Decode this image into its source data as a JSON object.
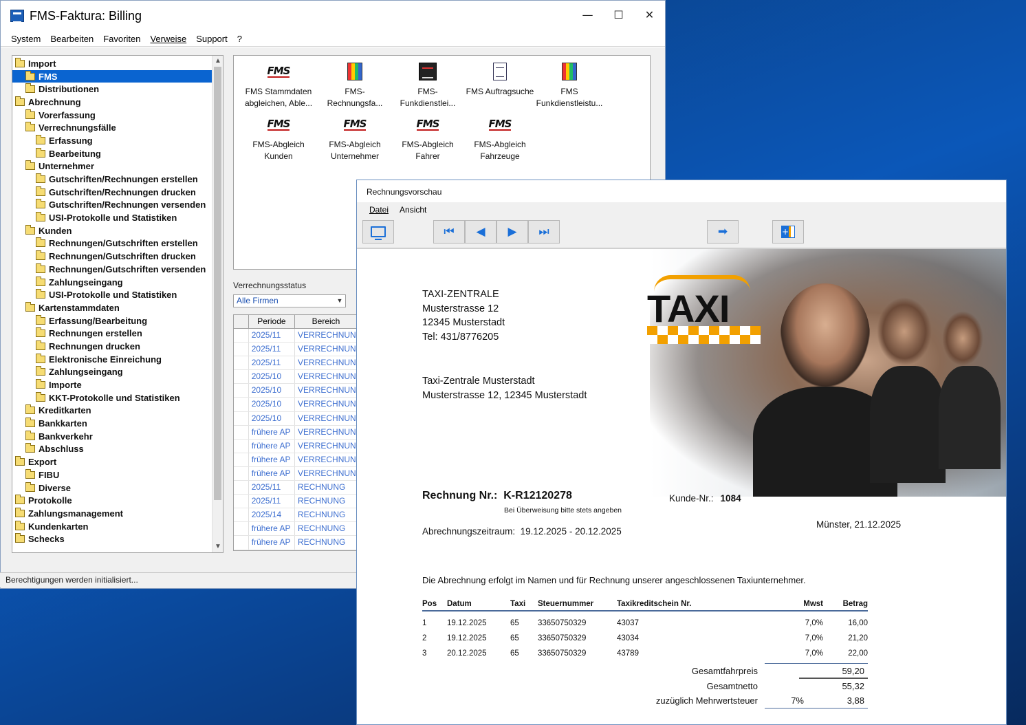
{
  "main_window": {
    "title": "FMS-Faktura: Billing",
    "controls": {
      "minimize": "—",
      "maximize": "☐",
      "close": "✕"
    },
    "menu": [
      "System",
      "Bearbeiten",
      "Favoriten",
      "Verweise",
      "Support",
      "?"
    ],
    "tree": [
      {
        "label": "Import",
        "level": 0
      },
      {
        "label": "FMS",
        "level": 1,
        "selected": true
      },
      {
        "label": "Distributionen",
        "level": 1
      },
      {
        "label": "Abrechnung",
        "level": 0
      },
      {
        "label": "Vorerfassung",
        "level": 1
      },
      {
        "label": "Verrechnungsfälle",
        "level": 1
      },
      {
        "label": "Erfassung",
        "level": 2
      },
      {
        "label": "Bearbeitung",
        "level": 2
      },
      {
        "label": "Unternehmer",
        "level": 1
      },
      {
        "label": "Gutschriften/Rechnungen erstellen",
        "level": 2
      },
      {
        "label": "Gutschriften/Rechnungen drucken",
        "level": 2
      },
      {
        "label": "Gutschriften/Rechnungen versenden",
        "level": 2
      },
      {
        "label": "USI-Protokolle und Statistiken",
        "level": 2
      },
      {
        "label": "Kunden",
        "level": 1
      },
      {
        "label": "Rechnungen/Gutschriften erstellen",
        "level": 2
      },
      {
        "label": "Rechnungen/Gutschriften drucken",
        "level": 2
      },
      {
        "label": "Rechnungen/Gutschriften versenden",
        "level": 2
      },
      {
        "label": "Zahlungseingang",
        "level": 2
      },
      {
        "label": "USI-Protokolle und Statistiken",
        "level": 2
      },
      {
        "label": "Kartenstammdaten",
        "level": 1
      },
      {
        "label": "Erfassung/Bearbeitung",
        "level": 2
      },
      {
        "label": "Rechnungen erstellen",
        "level": 2
      },
      {
        "label": "Rechnungen drucken",
        "level": 2
      },
      {
        "label": "Elektronische Einreichung",
        "level": 2
      },
      {
        "label": "Zahlungseingang",
        "level": 2
      },
      {
        "label": "Importe",
        "level": 2
      },
      {
        "label": "KKT-Protokolle und Statistiken",
        "level": 2
      },
      {
        "label": "Kreditkarten",
        "level": 1
      },
      {
        "label": "Bankkarten",
        "level": 1
      },
      {
        "label": "Bankverkehr",
        "level": 1
      },
      {
        "label": "Abschluss",
        "level": 1
      },
      {
        "label": "Export",
        "level": 0
      },
      {
        "label": "FIBU",
        "level": 1
      },
      {
        "label": "Diverse",
        "level": 1
      },
      {
        "label": "Protokolle",
        "level": 0
      },
      {
        "label": "Zahlungsmanagement",
        "level": 0
      },
      {
        "label": "Kundenkarten",
        "level": 0
      },
      {
        "label": "Schecks",
        "level": 0
      }
    ],
    "icons": [
      {
        "icon": "fms-logo-icon",
        "line1": "FMS Stammdaten",
        "line2": "abgleichen, Able..."
      },
      {
        "icon": "multicolor-report-icon",
        "line1": "FMS-Rechnungsfa...",
        "line2": ""
      },
      {
        "icon": "radio-device-icon",
        "line1": "FMS-Funkdienstlei...",
        "line2": ""
      },
      {
        "icon": "document-icon",
        "line1": "FMS Auftragsuche",
        "line2": ""
      },
      {
        "icon": "multicolor-report-icon",
        "line1": "FMS",
        "line2": "Funkdienstleistu..."
      },
      {
        "icon": "fms-logo-icon",
        "line1": "FMS-Abgleich",
        "line2": "Kunden"
      },
      {
        "icon": "fms-logo-icon",
        "line1": "FMS-Abgleich",
        "line2": "Unternehmer"
      },
      {
        "icon": "fms-logo-icon",
        "line1": "FMS-Abgleich",
        "line2": "Fahrer"
      },
      {
        "icon": "fms-logo-icon",
        "line1": "FMS-Abgleich",
        "line2": "Fahrzeuge"
      }
    ],
    "fms_logo_text": "FMS",
    "status_label": "Verrechnungsstatus",
    "status_select": "Alle Firmen",
    "grid_headers": [
      "Periode",
      "Bereich"
    ],
    "grid_rows": [
      [
        "2025/11",
        "VERRECHNUNGS"
      ],
      [
        "2025/11",
        "VERRECHNUNGS"
      ],
      [
        "2025/11",
        "VERRECHNUNGS"
      ],
      [
        "2025/10",
        "VERRECHNUNGS"
      ],
      [
        "2025/10",
        "VERRECHNUNGS"
      ],
      [
        "2025/10",
        "VERRECHNUNGS"
      ],
      [
        "2025/10",
        "VERRECHNUNGS"
      ],
      [
        "frühere AP",
        "VERRECHNUNGS"
      ],
      [
        "frühere AP",
        "VERRECHNUNGS"
      ],
      [
        "frühere AP",
        "VERRECHNUNGS"
      ],
      [
        "frühere AP",
        "VERRECHNUNGS"
      ],
      [
        "2025/11",
        "RECHNUNG"
      ],
      [
        "2025/11",
        "RECHNUNG"
      ],
      [
        "2025/14",
        "RECHNUNG"
      ],
      [
        "frühere AP",
        "RECHNUNG"
      ],
      [
        "frühere AP",
        "RECHNUNG"
      ]
    ],
    "statusbar": "Berechtigungen werden initialisiert..."
  },
  "preview": {
    "title": "Rechnungsvorschau",
    "menu": [
      "Datei",
      "Ansicht"
    ],
    "doc": {
      "sender": [
        "TAXI-ZENTRALE",
        "Musterstrasse 12",
        "12345 Musterstadt",
        "Tel:   431/8776205"
      ],
      "recipient": [
        "Taxi-Zentrale Musterstadt",
        "Musterstrasse 12, 12345 Musterstadt"
      ],
      "logo_word": "TAXI",
      "invoice_label": "Rechnung Nr.:",
      "invoice_no": "K-R12120278",
      "invoice_hint": "Bei Überweisung bitte stets angeben",
      "customer_label": "Kunde-Nr.:",
      "customer_no": "1084",
      "place_date": "Münster, 21.12.2025",
      "period_label": "Abrechnungszeitraum:",
      "period": "19.12.2025 - 20.12.2025",
      "note": "Die Abrechnung erfolgt im Namen und für Rechnung unserer angeschlossenen Taxiunternehmer.",
      "table_headers": [
        "Pos",
        "Datum",
        "Taxi",
        "Steuernummer",
        "Taxikreditschein Nr.",
        "Mwst",
        "Betrag"
      ],
      "table_rows": [
        [
          "1",
          "19.12.2025",
          "65",
          "33650750329",
          "43037",
          "7,0%",
          "16,00"
        ],
        [
          "2",
          "19.12.2025",
          "65",
          "33650750329",
          "43034",
          "7,0%",
          "21,20"
        ],
        [
          "3",
          "20.12.2025",
          "65",
          "33650750329",
          "43789",
          "7,0%",
          "22,00"
        ]
      ],
      "totals": {
        "gesamt_label": "Gesamtfahrpreis",
        "gesamt": "59,20",
        "netto_label": "Gesamtnetto",
        "netto": "55,32",
        "mwst_label": "zuzüglich Mehrwertsteuer",
        "mwst_rate": "7%",
        "mwst": "3,88"
      }
    }
  },
  "colors": {
    "selection": "#0a64d0",
    "grid_text": "#3e6fd0",
    "taxi_orange": "#f2a000",
    "toolbar_icon": "#1a6fd8"
  }
}
